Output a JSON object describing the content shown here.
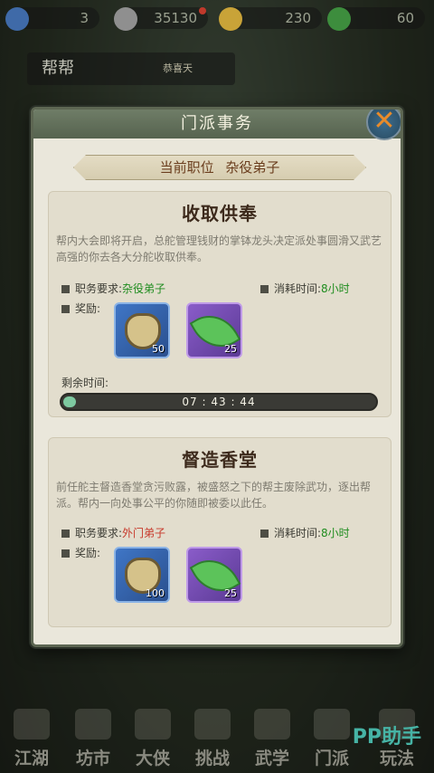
{
  "topbar": {
    "resources": [
      {
        "icon": "level-icon",
        "value": "3"
      },
      {
        "icon": "coin-icon",
        "value": "35130"
      },
      {
        "icon": "ingot-icon",
        "value": "230"
      },
      {
        "icon": "jade-icon",
        "value": "60"
      }
    ],
    "gang_title": "帮帮",
    "gang_name": "恭喜天"
  },
  "modal": {
    "title": "门派事务",
    "rank_label": "当前职位",
    "rank_value": "杂役弟子",
    "tasks": [
      {
        "title": "收取供奉",
        "description": "帮内大会即将开启，总舵管理钱财的掌钵龙头决定派处事圆滑又武艺高强的你去各大分舵收取供奉。",
        "req_label": "职务要求:",
        "req_value": "杂役弟子",
        "time_label": "消耗时间:",
        "time_value": "8小时",
        "reward_label": "奖励:",
        "rewards": [
          {
            "icon": "lock-icon",
            "count": "50"
          },
          {
            "icon": "leaf-icon",
            "count": "25"
          }
        ],
        "remaining_label": "剩余时间:",
        "remaining_time": "07 : 43 : 44",
        "progress": 0.04
      },
      {
        "title": "督造香堂",
        "description": "前任舵主督造香堂贪污败露，被盛怒之下的帮主废除武功，逐出帮派。帮内一向处事公平的你随即被委以此任。",
        "req_label": "职务要求:",
        "req_value": "外门弟子",
        "time_label": "消耗时间:",
        "time_value": "8小时",
        "reward_label": "奖励:",
        "rewards": [
          {
            "icon": "lock-icon",
            "count": "100"
          },
          {
            "icon": "leaf-icon",
            "count": "25"
          }
        ]
      }
    ]
  },
  "bottom_nav": [
    "江湖",
    "坊市",
    "大侠",
    "挑战",
    "武学",
    "门派",
    "玩法"
  ],
  "watermark": "PP助手",
  "colors": {
    "accent": "#e98b2a",
    "requirement_ok": "#1e8c1e",
    "requirement_locked": "#c7382a",
    "progress": "#7ec9a0"
  }
}
